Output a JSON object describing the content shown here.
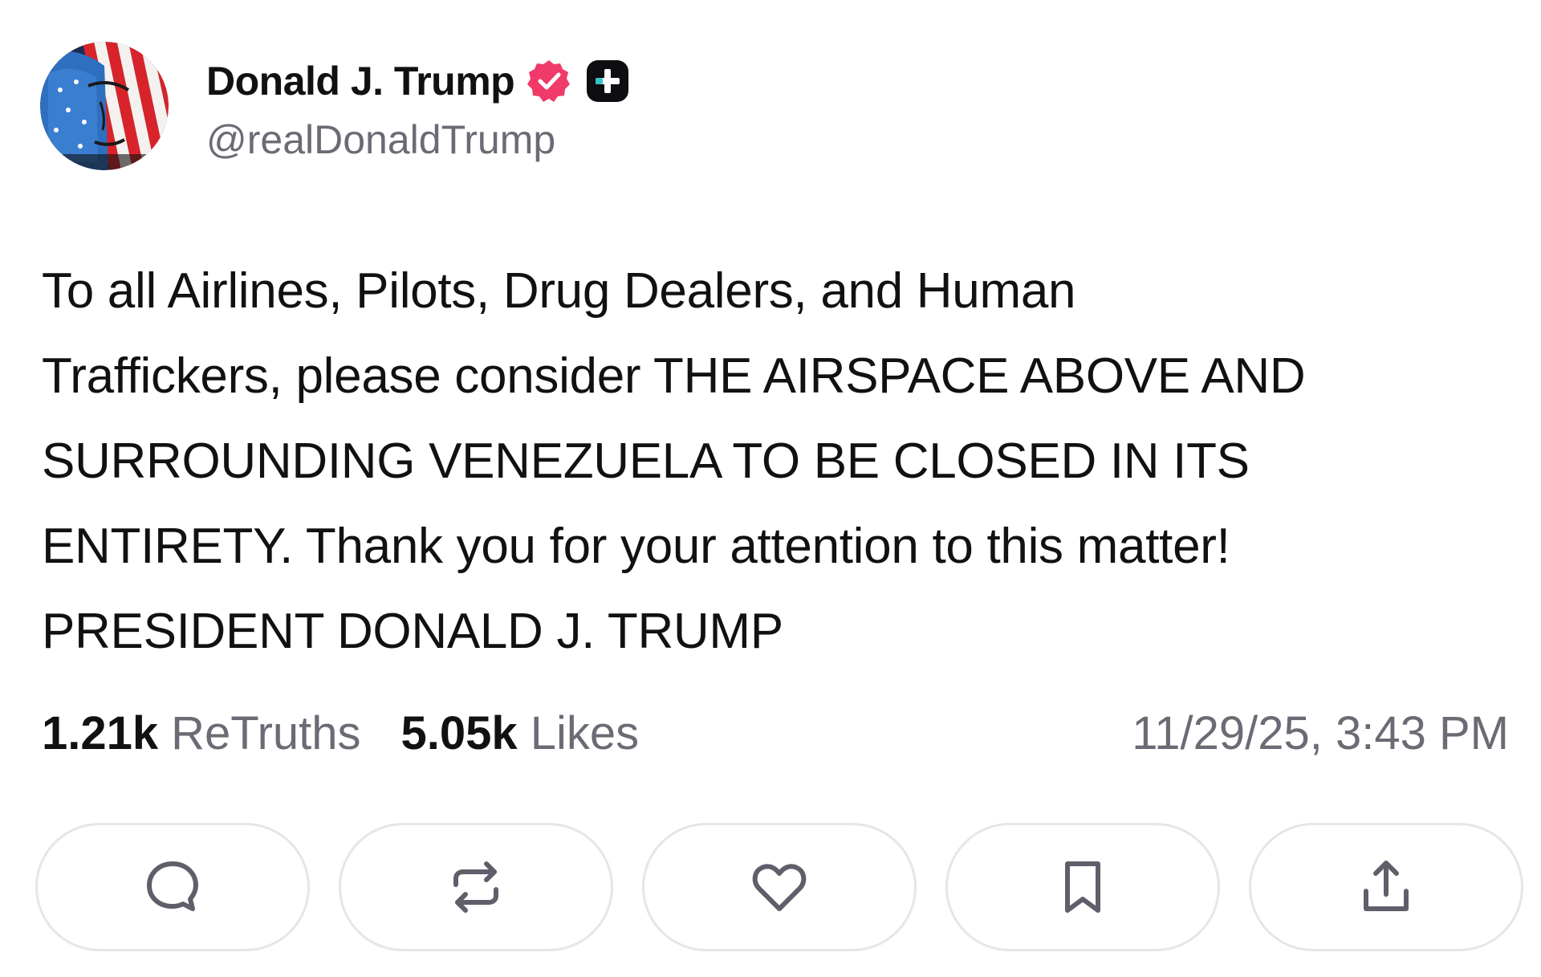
{
  "author": {
    "display_name": "Donald J. Trump",
    "handle": "@realDonaldTrump",
    "verified_icon": "verified-badge-icon",
    "badge_icon": "plus-badge-icon",
    "verified_color": "#f03a6a"
  },
  "post": {
    "text": "To all Airlines, Pilots, Drug Dealers, and Human\nTraffickers, please consider THE AIRSPACE ABOVE AND\nSURROUNDING VENEZUELA TO BE CLOSED IN ITS\nENTIRETY. Thank you for your attention to this matter!\nPRESIDENT DONALD J. TRUMP"
  },
  "stats": {
    "retruths_count": "1.21k",
    "retruths_label": "ReTruths",
    "likes_count": "5.05k",
    "likes_label": "Likes",
    "timestamp": "11/29/25, 3:43 PM"
  },
  "actions": [
    {
      "name": "reply",
      "icon": "reply-icon"
    },
    {
      "name": "retruth",
      "icon": "retruth-icon"
    },
    {
      "name": "like",
      "icon": "heart-icon"
    },
    {
      "name": "bookmark",
      "icon": "bookmark-icon"
    },
    {
      "name": "share",
      "icon": "share-icon"
    }
  ],
  "colors": {
    "text_primary": "#111111",
    "text_secondary": "#6b6b75",
    "button_border": "#e6e6ea",
    "icon_color": "#5f5f6b"
  }
}
